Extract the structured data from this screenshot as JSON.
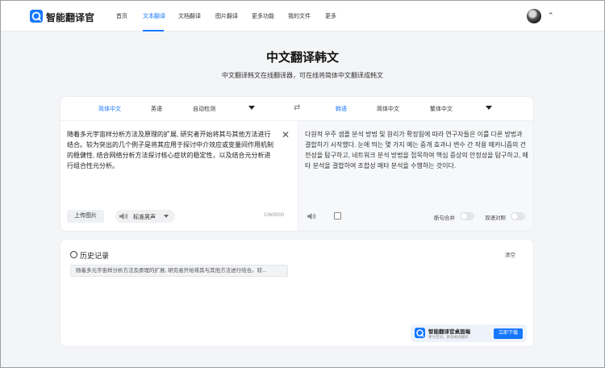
{
  "nav": {
    "brand": "智能翻译官",
    "links": [
      "首页",
      "文本翻译",
      "文档翻译",
      "图片翻译",
      "更多功能",
      "我的文件",
      "更多"
    ],
    "active_index": 1
  },
  "page": {
    "title": "中文翻译韩文",
    "subtitle": "中文翻译韩文在线翻译器，可在线将简体中文翻译成韩文"
  },
  "source_langs": [
    "简体中文",
    "英语",
    "自动检测"
  ],
  "target_langs": [
    "韩语",
    "简体中文",
    "繁体中文"
  ],
  "source": {
    "text": "随着多元宇宙样分析方法及原理的扩展, 研究者开始将其与其他方法进行结合。较为突出的几个例子是将其应用于探讨中介效应或变量间作用机制的稳健性, 结合网络分析方法探讨核心症状的稳定性，以及结合元分析进行组合性元分析。",
    "upload_label": "上传图片",
    "voice_label": "标准男声",
    "counter": "106/5000"
  },
  "target": {
    "text": "다원적 우주 샘플 분석 방법 및 원리가 확장됨에 따라 연구자들은 이를 다른 방법과 결합하기 시작했다. 눈에 띄는 몇 가지 예는 중개 효과나 변수 간 작용 메커니즘의 건전성을 탐구하고, 네트워크 분석 방법을 접목하여 핵심 증상의 안정성을 탐구하고, 메타 분석을 결합하여 조합성 메타 분석을 수행하는 것이다.",
    "toggle1_label": "断句合并",
    "toggle2_label": "双语对照"
  },
  "history": {
    "title": "历史记录",
    "clear_label": "清空",
    "item": "随着多元宇宙样分析方法及原理的扩展, 研究者开始将其与其他方法进行结合。较..."
  },
  "promo": {
    "title": "智能翻译官桌面端",
    "subtitle": "更大空间，更多格式翻译",
    "button": "立即下载"
  },
  "colors": {
    "accent": "#1677ff",
    "background": "#f4f5f7"
  }
}
